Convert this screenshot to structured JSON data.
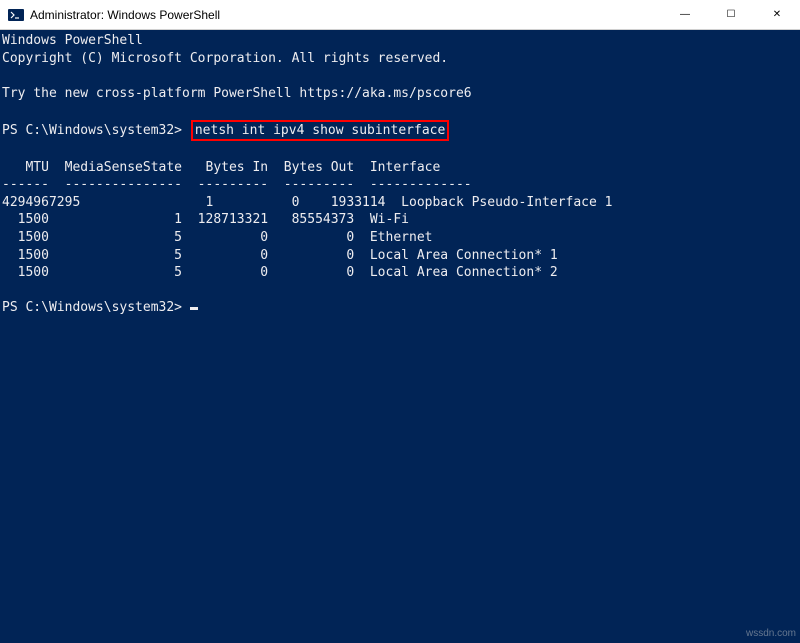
{
  "window": {
    "title": "Administrator: Windows PowerShell"
  },
  "controls": {
    "minimize": "—",
    "maximize": "☐",
    "close": "✕"
  },
  "terminal": {
    "banner1": "Windows PowerShell",
    "banner2": "Copyright (C) Microsoft Corporation. All rights reserved.",
    "banner3": "Try the new cross-platform PowerShell https://aka.ms/pscore6",
    "prompt1_prefix": "PS C:\\Windows\\system32> ",
    "command1": "netsh int ipv4 show subinterface",
    "header_row": "   MTU  MediaSenseState   Bytes In  Bytes Out  Interface",
    "dashes_row": "------  ---------------  ---------  ---------  -------------",
    "rows": [
      "4294967295                1          0    1933114  Loopback Pseudo-Interface 1",
      "  1500                1  128713321   85554373  Wi-Fi",
      "  1500                5          0          0  Ethernet",
      "  1500                5          0          0  Local Area Connection* 1",
      "  1500                5          0          0  Local Area Connection* 2"
    ],
    "prompt2": "PS C:\\Windows\\system32> "
  },
  "watermark": "wssdn.com"
}
